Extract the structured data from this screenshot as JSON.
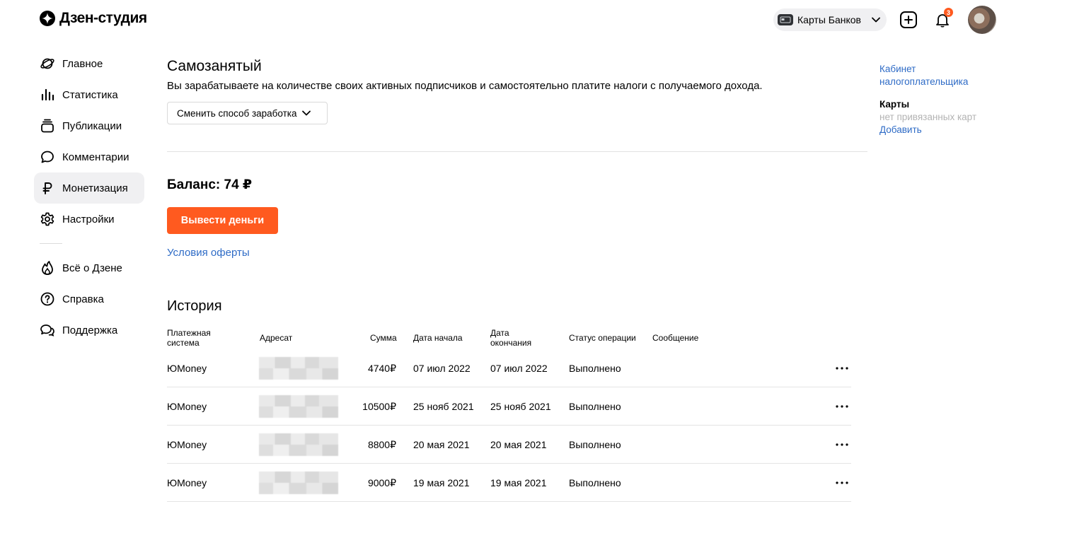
{
  "header": {
    "logo_text": "Дзен-студия",
    "channel_name": "Карты Банков",
    "notifications_count": "3"
  },
  "sidebar": {
    "items": [
      {
        "label": "Главное",
        "icon": "planet-icon"
      },
      {
        "label": "Статистика",
        "icon": "bar-chart-icon"
      },
      {
        "label": "Публикации",
        "icon": "stack-icon"
      },
      {
        "label": "Комментарии",
        "icon": "comment-icon"
      },
      {
        "label": "Монетизация",
        "icon": "ruble-icon",
        "active": true
      },
      {
        "label": "Настройки",
        "icon": "gear-icon"
      }
    ],
    "secondary": [
      {
        "label": "Всё о Дзене",
        "icon": "flame-icon"
      },
      {
        "label": "Справка",
        "icon": "help-circle-icon"
      },
      {
        "label": "Поддержка",
        "icon": "chat-bubbles-icon"
      }
    ]
  },
  "main": {
    "title": "Самозанятый",
    "description": "Вы зарабатываете на количестве своих активных подписчиков и самостоятельно платите налоги с получаемого дохода.",
    "change_method_label": "Сменить способ заработка",
    "balance_label": "Баланс: 74 ₽",
    "withdraw_label": "Вывести деньги",
    "offer_link": "Условия оферты",
    "history_title": "История"
  },
  "history": {
    "columns": [
      "Платежная система",
      "Адресат",
      "Сумма",
      "Дата начала",
      "Дата окончания",
      "Статус операции",
      "Сообщение"
    ],
    "rows": [
      {
        "system": "ЮMoney",
        "amount": "4740₽",
        "start": "07 июл 2022",
        "end": "07 июл 2022",
        "status": "Выполнено"
      },
      {
        "system": "ЮMoney",
        "amount": "10500₽",
        "start": "25 нояб 2021",
        "end": "25 нояб 2021",
        "status": "Выполнено"
      },
      {
        "system": "ЮMoney",
        "amount": "8800₽",
        "start": "20 мая 2021",
        "end": "20 мая 2021",
        "status": "Выполнено"
      },
      {
        "system": "ЮMoney",
        "amount": "9000₽",
        "start": "19 мая 2021",
        "end": "19 мая 2021",
        "status": "Выполнено"
      }
    ]
  },
  "right_panel": {
    "taxpayer_link": "Кабинет налогоплательщика",
    "cards_label": "Карты",
    "no_cards_text": "нет привязанных карт",
    "add_link": "Добавить"
  },
  "colors": {
    "accent": "#ff5a1f",
    "link": "#2e6bc6",
    "active_bg": "#f0f0f2"
  }
}
